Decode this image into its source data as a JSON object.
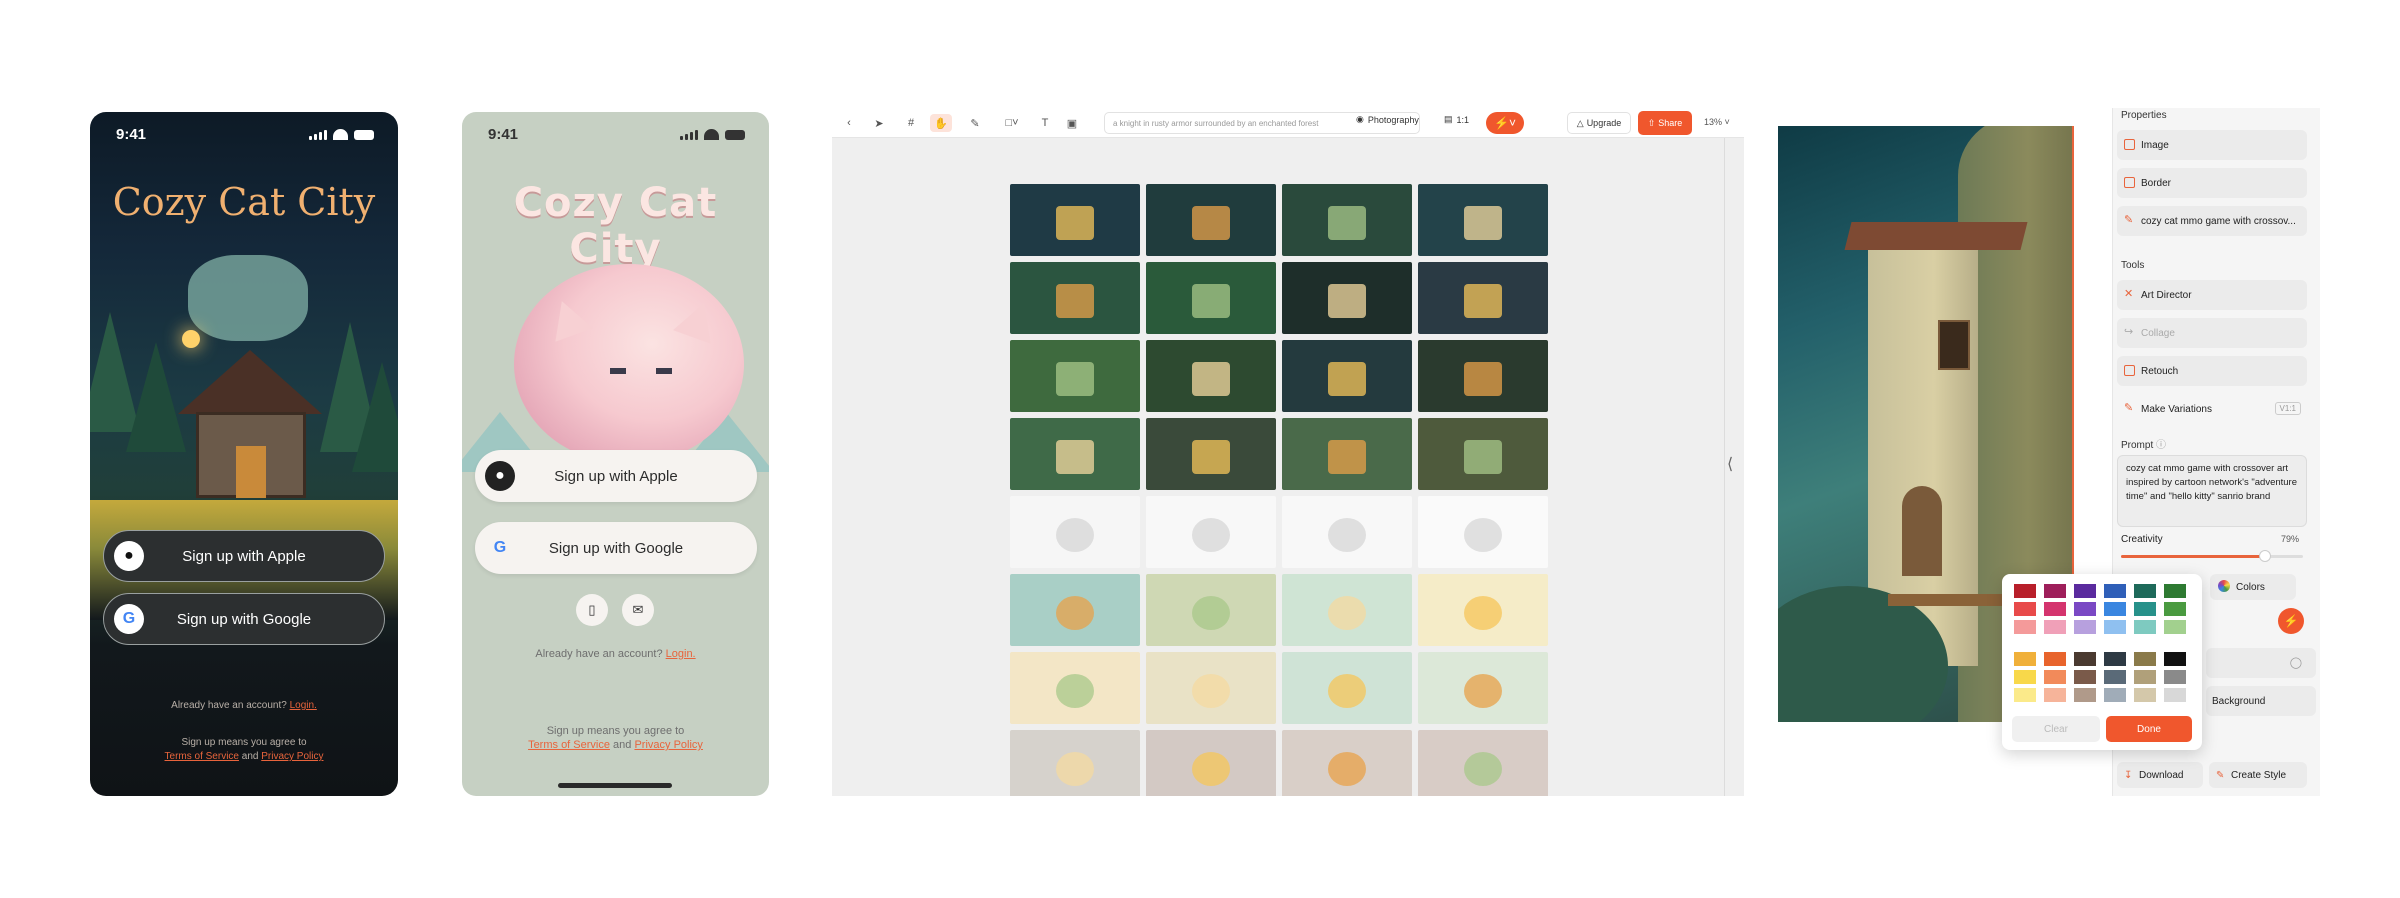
{
  "phone1": {
    "time": "9:41",
    "title": "Cozy Cat City",
    "apple_btn": "Sign up with Apple",
    "google_btn": "Sign up with Google",
    "have_account": "Already have an account?",
    "login": "Login.",
    "agree": "Sign up means you agree to",
    "terms": "Terms of Service",
    "and": "and",
    "privacy": "Privacy Policy"
  },
  "phone2": {
    "time": "9:41",
    "title": "Cozy Cat City",
    "apple_btn": "Sign up with Apple",
    "google_btn": "Sign up with Google",
    "have_account": "Already have an account?",
    "login": "Login.",
    "agree": "Sign up means you agree to",
    "terms": "Terms of Service",
    "and": "and",
    "privacy": "Privacy Policy"
  },
  "editor": {
    "prompt_text": "a knight in rusty armor surrounded by an enchanted forest",
    "style": "Photography",
    "ratio": "1:1",
    "upgrade": "Upgrade",
    "share": "Share",
    "zoom": "13%",
    "grid": [
      [
        "#1f3a45",
        "#203c3d",
        "#2a4a3c",
        "#23434a"
      ],
      [
        "#2b5540",
        "#2a5a3a",
        "#1e2e2a",
        "#2a3a44"
      ],
      [
        "#3e6a3e",
        "#2d4a30",
        "#243a3e",
        "#2a3a2e"
      ],
      [
        "#3f6a48",
        "#3a4a3a",
        "#4a6a4a",
        "#4e5a3c"
      ],
      [
        "#f6f6f6",
        "#f8f8f8",
        "#f8f8f8",
        "#fafafa"
      ],
      [
        "#a9cfc6",
        "#cfd8b4",
        "#cfe4d4",
        "#f5ecc8"
      ],
      [
        "#f3e6c6",
        "#e9e2c6",
        "#cfe3d6",
        "#dce8d8"
      ],
      [
        "#d6d2cc",
        "#d3c9c4",
        "#d9cfc8",
        "#d8ccc6"
      ]
    ],
    "accent_colors": [
      "#f6c65a",
      "#e8a24a",
      "#a8c88a",
      "#f4d9a0"
    ]
  },
  "panel": {
    "properties": "Properties",
    "image": "Image",
    "border": "Border",
    "prompt_layer": "cozy cat mmo game with crossov...",
    "tools": "Tools",
    "art_director": "Art Director",
    "collage": "Collage",
    "retouch": "Retouch",
    "make_variations": "Make Variations",
    "variations_badge": "V1:1",
    "prompt_label": "Prompt",
    "prompt_value": "cozy cat mmo game with crossover art inspired by cartoon network's \"adventure time\" and \"hello kitty\" sanrio brand",
    "creativity_label": "Creativity",
    "creativity_value": "79%",
    "creativity_fraction": 0.79,
    "colors": "Colors",
    "background": "Background",
    "clear": "Clear",
    "done": "Done",
    "download": "Download",
    "create_style": "Create Style",
    "swatches": [
      [
        "#b81f2a",
        "#9e1e5a",
        "#5a2a9e",
        "#2f5fb8",
        "#1e6a5a",
        "#2e7a32"
      ],
      [
        "#e84a4a",
        "#d4346e",
        "#7a48c4",
        "#3a86e0",
        "#27918a",
        "#4a9a40"
      ],
      [
        "#f49a9a",
        "#f0a0b8",
        "#b7a0de",
        "#8fc0f0",
        "#7ecac0",
        "#a2d08e"
      ],
      [
        "#f0b03a",
        "#e8642c",
        "#4a3a30",
        "#2e3a44",
        "#8a7a4a",
        "#111111"
      ],
      [
        "#f8d84a",
        "#f28a5a",
        "#7a5a4a",
        "#5a6a78",
        "#b0a07a",
        "#8a8a8a"
      ],
      [
        "#fbea8a",
        "#f6b49a",
        "#b09a8a",
        "#a0acb8",
        "#d4c8aa",
        "#d8d8d8"
      ]
    ]
  }
}
